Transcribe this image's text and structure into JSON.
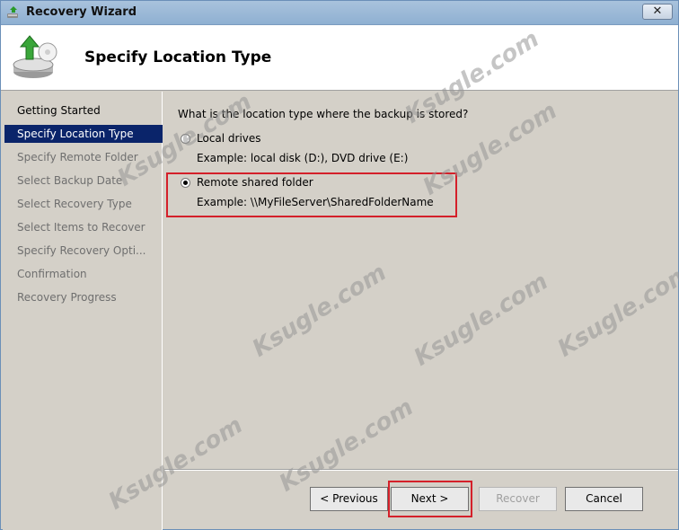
{
  "window": {
    "title": "Recovery Wizard",
    "close_label": "✕"
  },
  "header": {
    "title": "Specify Location Type"
  },
  "nav": {
    "items": [
      {
        "label": "Getting Started",
        "state": "done"
      },
      {
        "label": "Specify Location Type",
        "state": "active"
      },
      {
        "label": "Specify Remote Folder",
        "state": "pending"
      },
      {
        "label": "Select Backup Date",
        "state": "pending"
      },
      {
        "label": "Select Recovery Type",
        "state": "pending"
      },
      {
        "label": "Select Items to Recover",
        "state": "pending"
      },
      {
        "label": "Specify Recovery Opti...",
        "state": "pending"
      },
      {
        "label": "Confirmation",
        "state": "pending"
      },
      {
        "label": "Recovery Progress",
        "state": "pending"
      }
    ]
  },
  "content": {
    "question": "What is the location type where the backup is stored?",
    "options": [
      {
        "label": "Local drives",
        "example": "Example: local disk (D:), DVD drive (E:)",
        "checked": false
      },
      {
        "label": "Remote shared folder",
        "example": "Example: \\\\MyFileServer\\SharedFolderName",
        "checked": true
      }
    ]
  },
  "buttons": {
    "previous": "< Previous",
    "next": "Next >",
    "recover": "Recover",
    "cancel": "Cancel"
  },
  "watermark": {
    "text": "Ksugle.com"
  },
  "colors": {
    "selection": "#0a246a",
    "highlight": "#d4202a"
  }
}
